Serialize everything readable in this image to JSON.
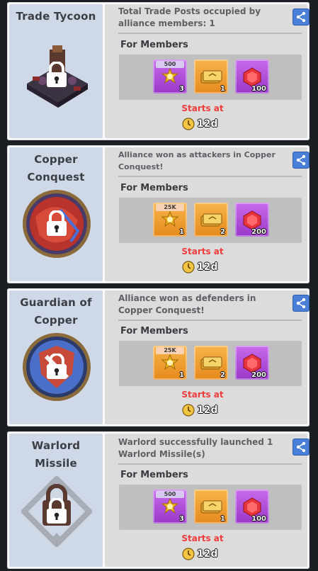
{
  "achievements": [
    {
      "title_lines": [
        "Trade Tycoon"
      ],
      "description": "Total Trade Posts occupied by alliance members: 1",
      "section_label": "For Members",
      "rewards": [
        {
          "tag": "500",
          "quantity": "3",
          "icon": "medal-icon",
          "bg": "purple"
        },
        {
          "tag": "",
          "quantity": "1",
          "icon": "gold-tickets-icon",
          "bg": "orange"
        },
        {
          "tag": "",
          "quantity": "100",
          "icon": "ruby-gem-icon",
          "bg": "purple"
        }
      ],
      "starts_at_label": "Starts at",
      "timer": "12d",
      "emblem": "trade-post-building-icon"
    },
    {
      "title_lines": [
        "Copper",
        "Conquest"
      ],
      "description": "Alliance won as attackers in Copper Conquest!",
      "section_label": "For Members",
      "rewards": [
        {
          "tag": "25K",
          "quantity": "1",
          "icon": "medal-icon",
          "bg": "orange"
        },
        {
          "tag": "",
          "quantity": "2",
          "icon": "gold-tickets-icon",
          "bg": "orange"
        },
        {
          "tag": "",
          "quantity": "200",
          "icon": "ruby-gem-icon",
          "bg": "purple"
        }
      ],
      "starts_at_label": "Starts at",
      "timer": "12d",
      "emblem": "copper-conquest-emblem-icon"
    },
    {
      "title_lines": [
        "Guardian of",
        "Copper"
      ],
      "description": "Alliance won as defenders in Copper Conquest!",
      "section_label": "For Members",
      "rewards": [
        {
          "tag": "25K",
          "quantity": "1",
          "icon": "medal-icon",
          "bg": "orange"
        },
        {
          "tag": "",
          "quantity": "2",
          "icon": "gold-tickets-icon",
          "bg": "orange"
        },
        {
          "tag": "",
          "quantity": "200",
          "icon": "ruby-gem-icon",
          "bg": "purple"
        }
      ],
      "starts_at_label": "Starts at",
      "timer": "12d",
      "emblem": "guardian-shield-emblem-icon"
    },
    {
      "title_lines": [
        "Warlord",
        "Missile"
      ],
      "description": "Warlord successfully launched 1 Warlord Missile(s)",
      "section_label": "For Members",
      "rewards": [
        {
          "tag": "500",
          "quantity": "3",
          "icon": "medal-icon",
          "bg": "purple"
        },
        {
          "tag": "",
          "quantity": "1",
          "icon": "gold-tickets-icon",
          "bg": "orange"
        },
        {
          "tag": "",
          "quantity": "100",
          "icon": "ruby-gem-icon",
          "bg": "purple"
        }
      ],
      "starts_at_label": "Starts at",
      "timer": "12d",
      "emblem": "missile-diamond-emblem-icon"
    }
  ],
  "colors": {
    "accent_red": "#ee3b3b",
    "share_blue": "#4a7fd8",
    "reward_purple": "#b04fe0",
    "reward_orange": "#f0a032"
  }
}
